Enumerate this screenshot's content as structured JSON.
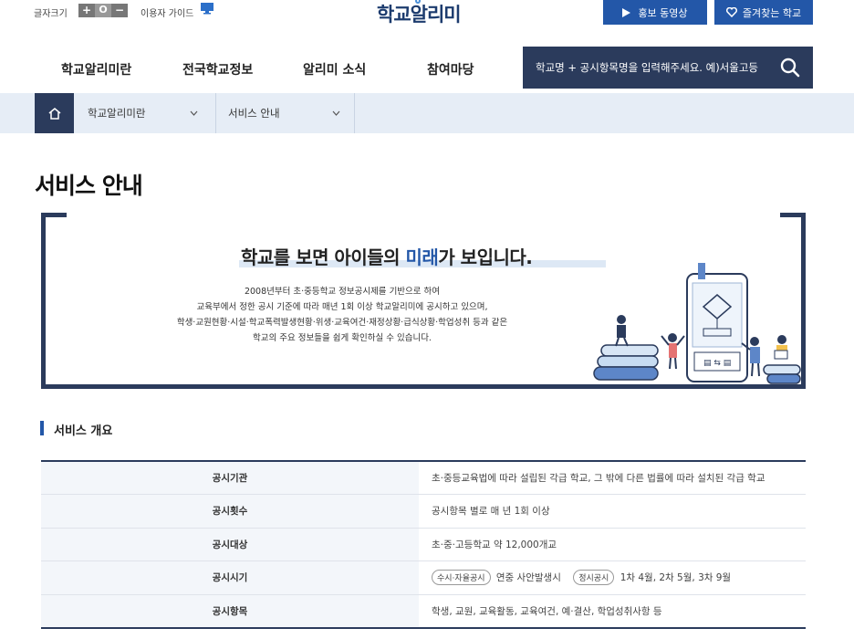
{
  "utility": {
    "font_size_label": "글자크기",
    "font_plus": "+",
    "font_reset": "O",
    "font_minus": "−",
    "guide_label": "이용자 가이드"
  },
  "logo": "학교알리미",
  "header_buttons": {
    "video": "홍보 동영상",
    "favorites": "즐겨찾는 학교"
  },
  "nav": {
    "items": [
      "학교알리미란",
      "전국학교정보",
      "알리미 소식",
      "참여마당"
    ]
  },
  "search": {
    "placeholder": "학교명 + 공시항목명을 입력해주세요. 예)서울고등"
  },
  "breadcrumb": {
    "items": [
      "학교알리미란",
      "서비스 안내"
    ]
  },
  "page_title": "서비스 안내",
  "banner": {
    "headline_pre": "학교를 보면 아이들의 ",
    "headline_hl": "미래",
    "headline_post": "가 보입니다.",
    "lines": [
      "2008년부터 초·중등학교 정보공시제를 기반으로 하여",
      "교육부에서 정한 공시 기준에 따라 매년 1회 이상 학교알리미에 공시하고 있으며,",
      "학생·교원현황·시설·학교폭력발생현황·위생·교육여건·재정상황·급식상황·학업성취 등과 같은",
      "학교의 주요 정보들을 쉽게 확인하실 수 있습니다."
    ]
  },
  "section_title": "서비스 개요",
  "overview": {
    "rows": [
      {
        "label": "공시기관",
        "value": "초·중등교육법에 따라 설립된 각급 학교, 그 밖에 다른 법률에 따라 설치된 각급 학교"
      },
      {
        "label": "공시횟수",
        "value": "공시항목 별로 매 년 1회 이상"
      },
      {
        "label": "공시대상",
        "value": "초·중·고등학교 약 12,000개교"
      },
      {
        "label": "공시시기",
        "tag1": "수시·자율공시",
        "text1": "연중 사안발생시",
        "tag2": "정시공시",
        "text2": "1차 4월, 2차 5월, 3차 9월"
      },
      {
        "label": "공시항목",
        "value": "학생, 교원, 교육활동, 교육여건, 예·결산, 학업성취사항 등"
      }
    ]
  },
  "colors": {
    "navy": "#2b3b5c",
    "accent_blue": "#2357a8",
    "crumb_bg": "#e6edf6"
  }
}
